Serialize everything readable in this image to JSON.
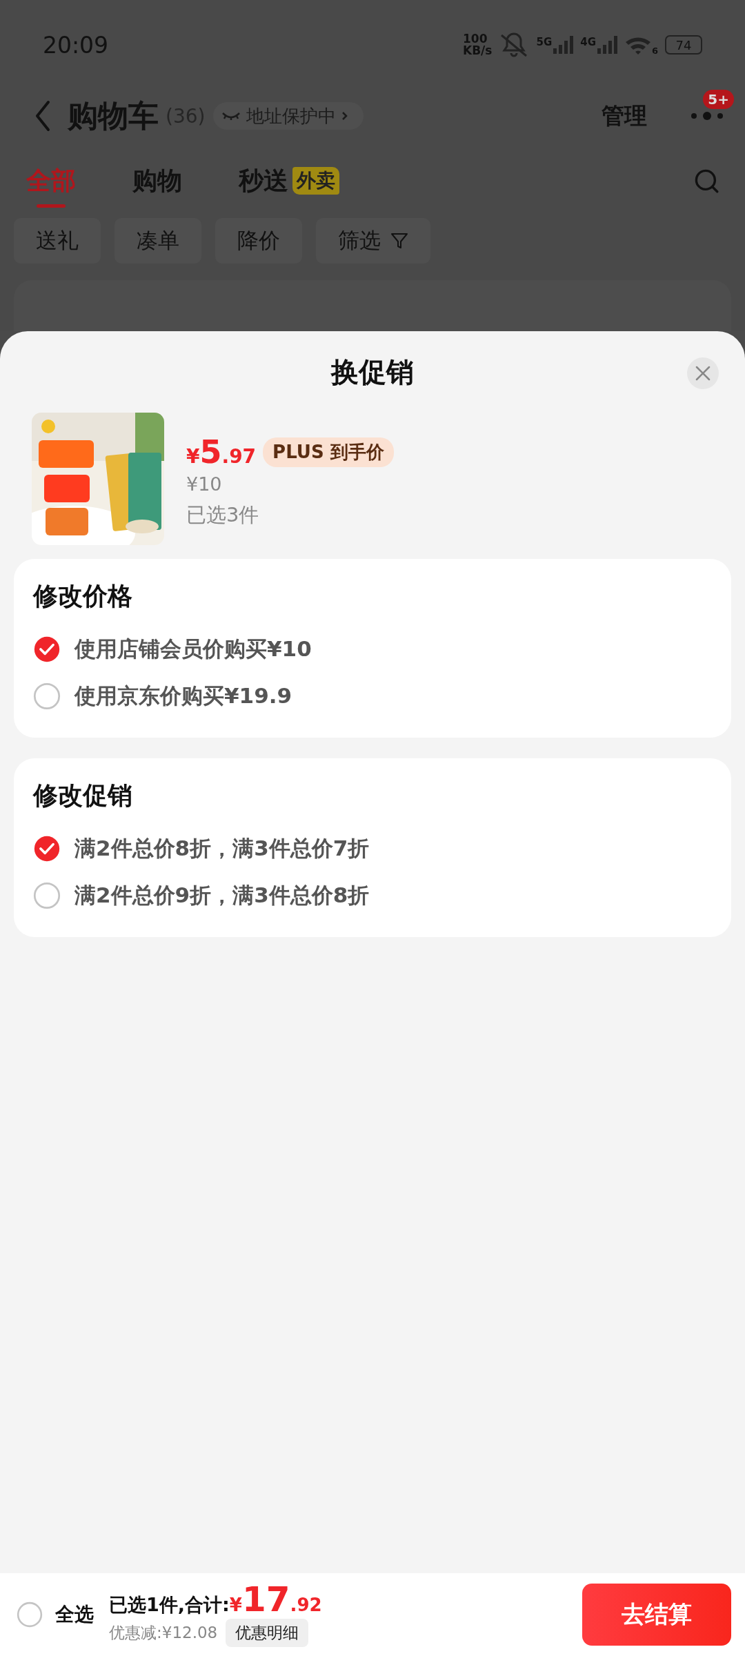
{
  "status_bar": {
    "time": "20:09",
    "net_speed": "100",
    "net_unit": "KB/s",
    "signals": [
      {
        "label": "5G"
      },
      {
        "label": "4G"
      }
    ],
    "wifi_label": "6",
    "battery": "74"
  },
  "header": {
    "title": "购物车",
    "count": "(36)",
    "address_badge": "地址保护中",
    "manage": "管理",
    "more_badge": "5+"
  },
  "tabs": [
    {
      "label": "全部",
      "selected": true
    },
    {
      "label": "购物",
      "selected": false
    },
    {
      "label": "秒送",
      "selected": false,
      "badge": "外卖"
    }
  ],
  "filters": [
    {
      "label": "送礼",
      "kind": "chip"
    },
    {
      "label": "凑单",
      "kind": "chip"
    },
    {
      "label": "降价",
      "kind": "chip"
    },
    {
      "label": "筛选",
      "kind": "filter"
    }
  ],
  "sheet": {
    "title": "换促销",
    "product": {
      "currency": "¥",
      "price_int": "5",
      "price_dec": ".97",
      "plus_tag": "PLUS 到手价",
      "original_price": "¥10",
      "selected_count": "已选3件"
    },
    "sections": [
      {
        "title": "修改价格",
        "options": [
          {
            "label": "使用店铺会员价购买¥10",
            "selected": true
          },
          {
            "label": "使用京东价购买¥19.9",
            "selected": false
          }
        ]
      },
      {
        "title": "修改促销",
        "options": [
          {
            "label": "满2件总价8折，满3件总价7折",
            "selected": true
          },
          {
            "label": "满2件总价9折，满3件总价8折",
            "selected": false
          }
        ]
      }
    ]
  },
  "bottom_bar": {
    "select_all": {
      "label": "全选",
      "selected": false
    },
    "summary": "已选1件,合计:",
    "currency": "¥",
    "total_int": "17",
    "total_dec": ".92",
    "discount": "优惠减:¥12.08",
    "detail_button": "优惠明细",
    "checkout": "去结算"
  }
}
